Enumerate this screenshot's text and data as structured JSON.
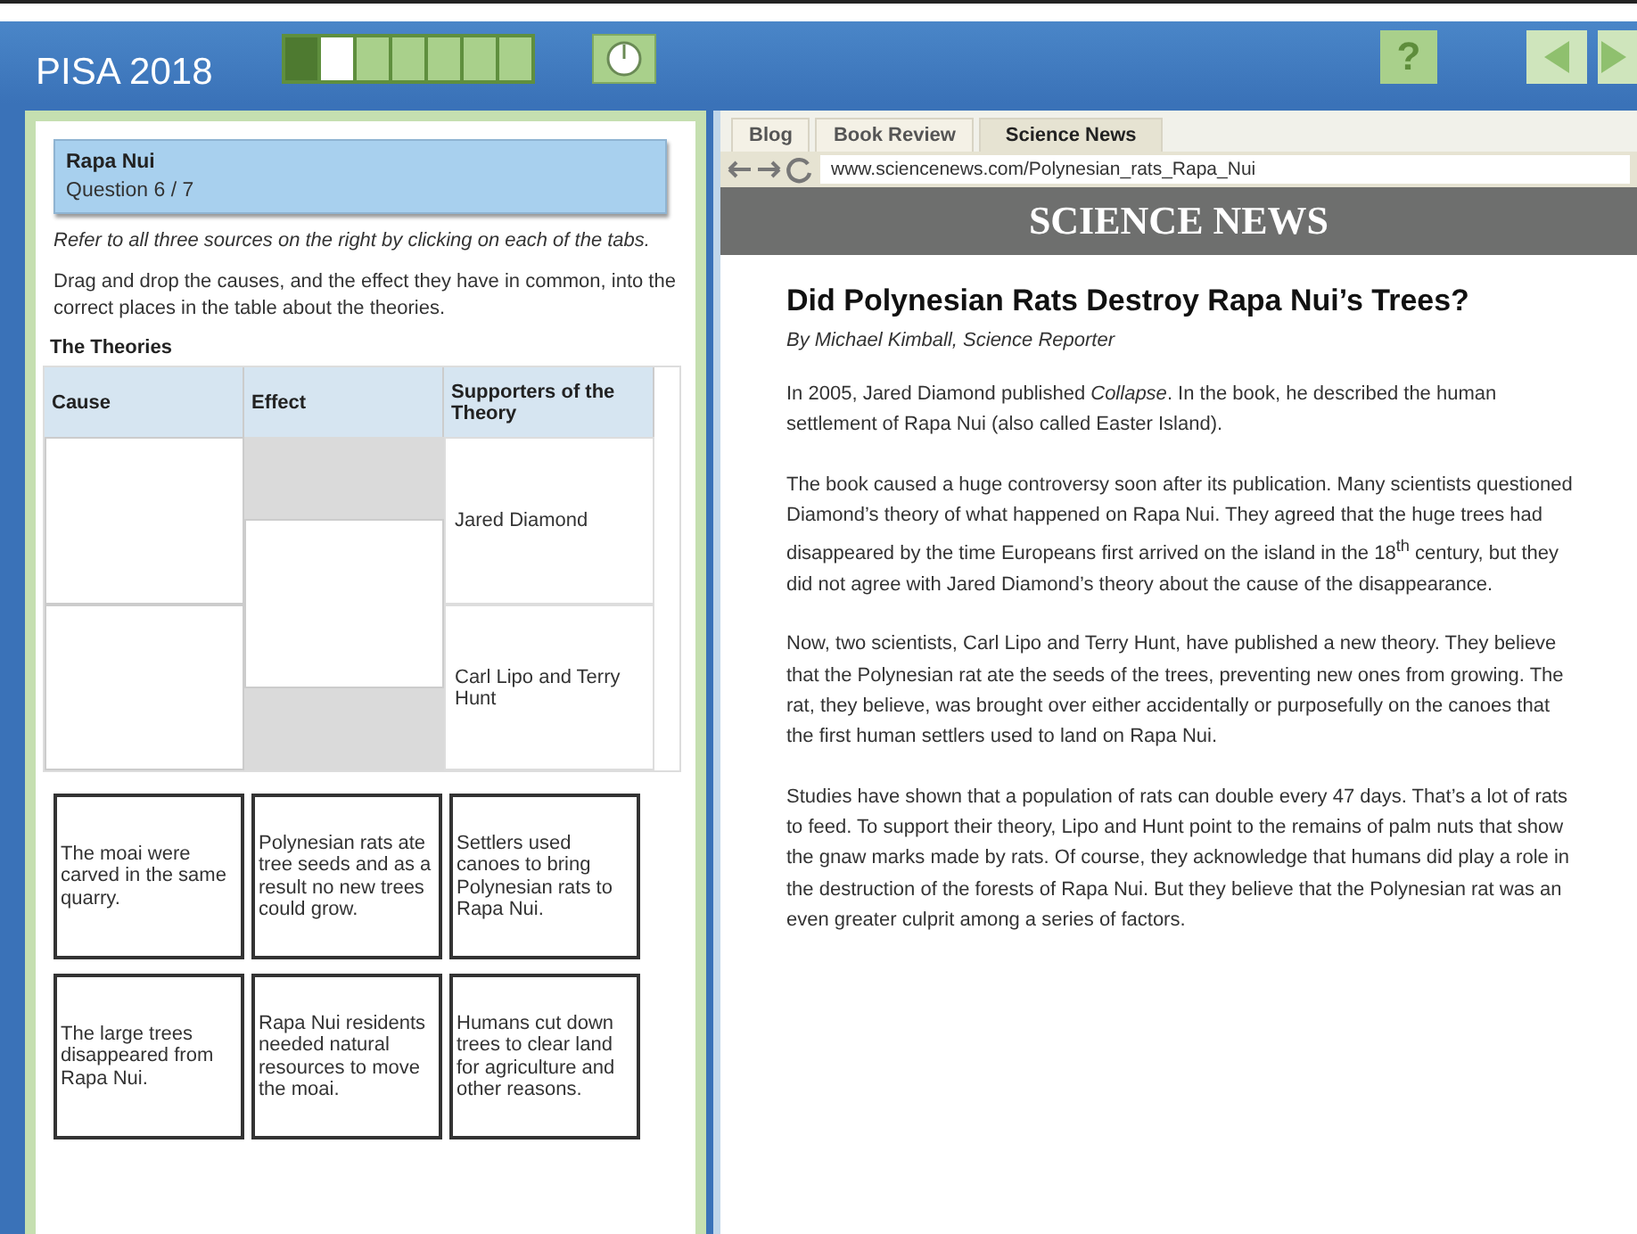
{
  "header": {
    "title": "PISA 2018",
    "progress": [
      {
        "completed": true,
        "selected": false
      },
      {
        "completed": false,
        "selected": true
      },
      {
        "completed": false,
        "selected": false
      },
      {
        "completed": false,
        "selected": false
      },
      {
        "completed": false,
        "selected": false
      },
      {
        "completed": false,
        "selected": false
      },
      {
        "completed": false,
        "selected": false
      }
    ],
    "help_label": "?"
  },
  "question": {
    "unit": "Rapa Nui",
    "number": "Question 6 / 7",
    "instructions": [
      "Refer to all three sources on the right by clicking on each of the tabs.",
      "Drag and drop the causes, and the effect they have in common, into the correct places in the table about the theories."
    ],
    "table_title": "The Theories",
    "columns": [
      "Cause",
      "Effect",
      "Supporters of the Theory"
    ],
    "supporters": [
      "Jared Diamond",
      "Carl Lipo and Terry Hunt"
    ],
    "cards": [
      "The moai were carved in the same quarry.",
      "Polynesian rats ate tree seeds and as a result no new trees could grow.",
      "Settlers used canoes to bring Polynesian rats to Rapa Nui.",
      "The large trees disappeared from Rapa Nui.",
      "Rapa Nui residents needed natural resources to move the moai.",
      "Humans cut down trees to clear land for agriculture and other reasons."
    ]
  },
  "browser": {
    "tabs": [
      {
        "label": "Blog",
        "selected": false
      },
      {
        "label": "Book Review",
        "selected": false
      },
      {
        "label": "Science News",
        "selected": true
      }
    ],
    "url": "www.sciencenews.com/Polynesian_rats_Rapa_Nui",
    "site_name": "SCIENCE NEWS",
    "headline": "Did Polynesian Rats Destroy Rapa Nui’s Trees?",
    "byline": "By Michael Kimball, Science Reporter",
    "paragraphs": [
      "In 2005, Jared Diamond published *Collapse*. In the book, he described the human settlement of Rapa Nui (also called Easter Island).",
      "The book caused a huge controversy soon after its publication. Many scientists questioned Diamond’s theory of what happened on Rapa Nui. They agreed that the huge trees had disappeared by the time Europeans first arrived on the island in the 18$^{th}$ century, but they did not agree with Jared Diamond’s theory about the cause of the disappearance.",
      "Now, two scientists, Carl Lipo and Terry Hunt, have published a new theory. They believe that the Polynesian rat ate the seeds of the trees, preventing new ones from growing. The rat, they believe, was brought over either accidentally or purposefully on the canoes that the first human settlers used to land on Rapa Nui.",
      "Studies have shown that a population of rats can double every 47 days. That’s a lot of rats to feed. To support their theory, Lipo and Hunt point to the remains of palm nuts that show the gnaw marks made by rats. Of course, they acknowledge that humans did play a role in the destruction of the forests of Rapa Nui. But they believe that the Polynesian rat was an even greater culprit among a series of factors."
    ]
  }
}
